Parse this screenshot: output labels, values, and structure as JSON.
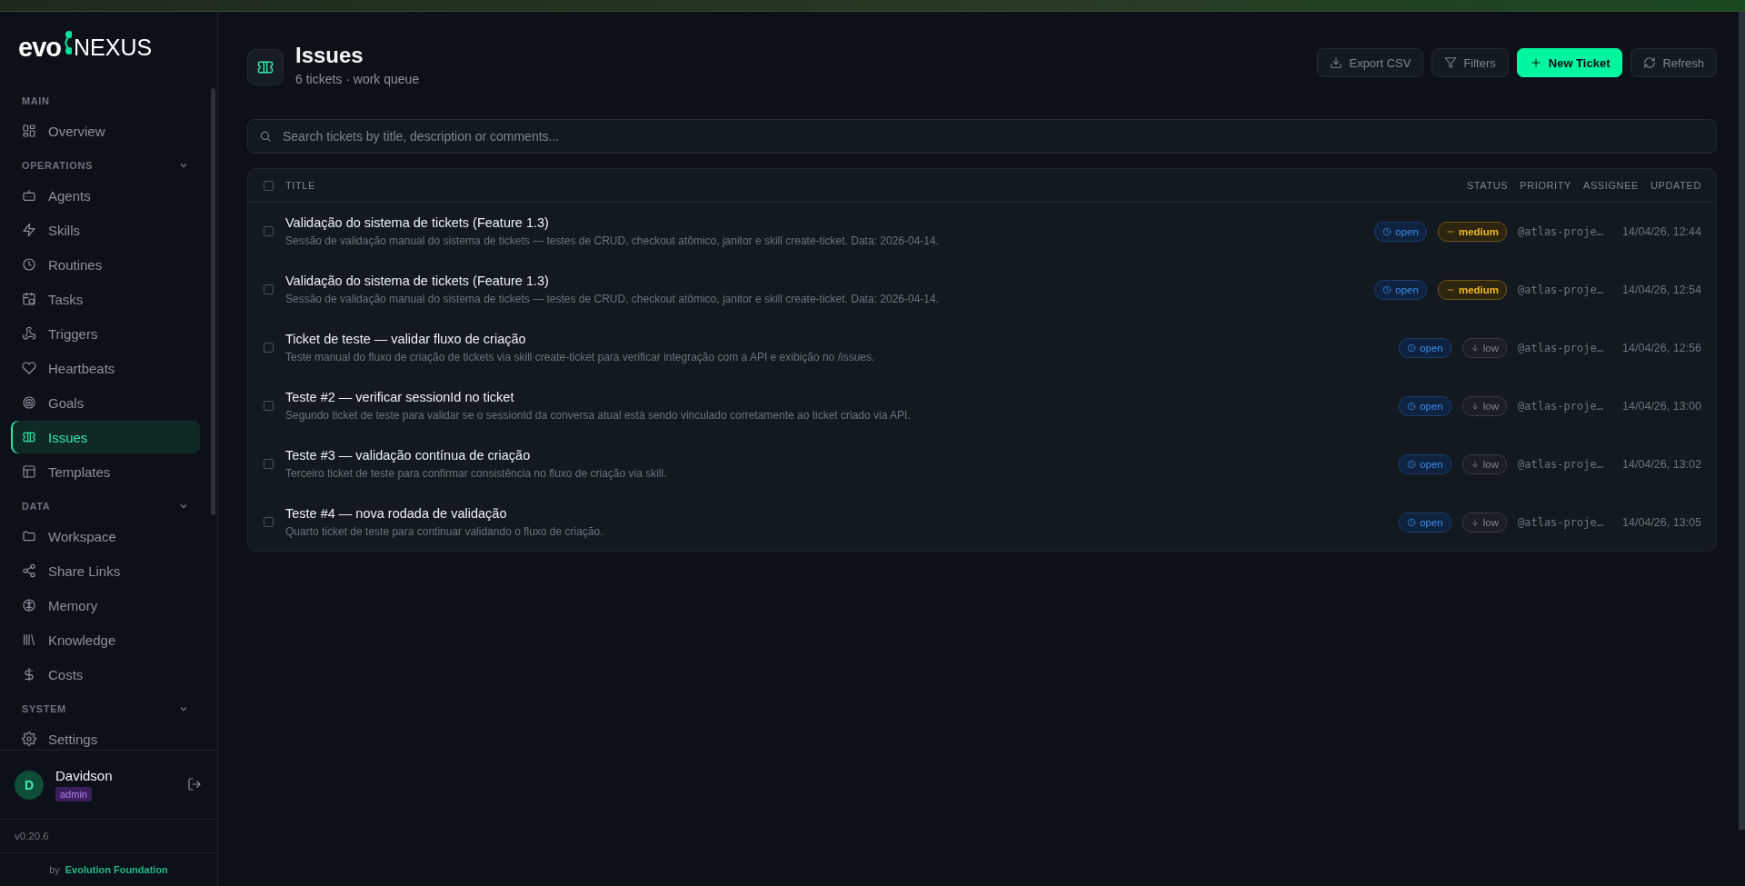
{
  "logo": {
    "mark": "evo",
    "name": "NEXUS"
  },
  "sidebar": {
    "sections": [
      {
        "title": "MAIN",
        "kind": "plain",
        "items": [
          {
            "label": "Overview",
            "selected": false
          }
        ]
      },
      {
        "title": "OPERATIONS",
        "kind": "collapsible",
        "expanded": true,
        "items": [
          {
            "label": "Agents",
            "selected": false
          },
          {
            "label": "Skills",
            "selected": false
          },
          {
            "label": "Routines",
            "selected": false
          },
          {
            "label": "Tasks",
            "selected": false
          },
          {
            "label": "Triggers",
            "selected": false
          },
          {
            "label": "Heartbeats",
            "selected": false
          },
          {
            "label": "Goals",
            "selected": false
          },
          {
            "label": "Issues",
            "selected": true
          },
          {
            "label": "Templates",
            "selected": false
          }
        ]
      },
      {
        "title": "DATA",
        "kind": "collapsible",
        "expanded": true,
        "items": [
          {
            "label": "Workspace",
            "selected": false
          },
          {
            "label": "Share Links",
            "selected": false
          },
          {
            "label": "Memory",
            "selected": false
          },
          {
            "label": "Knowledge",
            "selected": false
          },
          {
            "label": "Costs",
            "selected": false
          }
        ]
      },
      {
        "title": "SYSTEM",
        "kind": "collapsible",
        "expanded": true,
        "items": [
          {
            "label": "Settings",
            "selected": false
          }
        ]
      }
    ]
  },
  "user": {
    "initial": "D",
    "name": "Davidson",
    "role": "admin"
  },
  "version": "v0.20.6",
  "credit": {
    "prefix": "by",
    "link": "Evolution Foundation"
  },
  "page": {
    "title": "Issues",
    "subtitle": "6 tickets · work queue"
  },
  "actions": [
    {
      "label": "Export CSV",
      "kind": "export"
    },
    {
      "label": "Filters",
      "kind": "filter"
    },
    {
      "label": "New Ticket",
      "kind": "primary"
    },
    {
      "label": "Refresh",
      "kind": "refresh"
    }
  ],
  "search": {
    "placeholder": "Search tickets by title, description or comments..."
  },
  "table": {
    "select_all_checked": false,
    "columns": [
      "TITLE",
      "STATUS",
      "PRIORITY",
      "ASSIGNEE",
      "UPDATED"
    ],
    "rows": [
      {
        "checked": false,
        "title": "Validação do sistema de tickets (Feature 1.3)",
        "description": "Sessão de validação manual do sistema de tickets — testes de CRUD, checkout atômico, janitor e skill create-ticket. Data: 2026-04-14.",
        "status": {
          "label": "open",
          "kind": "open"
        },
        "priority": {
          "label": "medium",
          "kind": "medium"
        },
        "assignee": "@atlas-proje…",
        "updated": "14/04/26, 12:44"
      },
      {
        "checked": false,
        "title": "Validação do sistema de tickets (Feature 1.3)",
        "description": "Sessão de validação manual do sistema de tickets — testes de CRUD, checkout atômico, janitor e skill create-ticket. Data: 2026-04-14.",
        "status": {
          "label": "open",
          "kind": "open"
        },
        "priority": {
          "label": "medium",
          "kind": "medium"
        },
        "assignee": "@atlas-proje…",
        "updated": "14/04/26, 12:54"
      },
      {
        "checked": false,
        "title": "Ticket de teste — validar fluxo de criação",
        "description": "Teste manual do fluxo de criação de tickets via skill create-ticket para verificar integração com a API e exibição no /issues.",
        "status": {
          "label": "open",
          "kind": "open"
        },
        "priority": {
          "label": "low",
          "kind": "low"
        },
        "assignee": "@atlas-proje…",
        "updated": "14/04/26, 12:56"
      },
      {
        "checked": false,
        "title": "Teste #2 — verificar sessionId no ticket",
        "description": "Segundo ticket de teste para validar se o sessionId da conversa atual está sendo vinculado corretamente ao ticket criado via API.",
        "status": {
          "label": "open",
          "kind": "open"
        },
        "priority": {
          "label": "low",
          "kind": "low"
        },
        "assignee": "@atlas-proje…",
        "updated": "14/04/26, 13:00"
      },
      {
        "checked": false,
        "title": "Teste #3 — validação contínua de criação",
        "description": "Terceiro ticket de teste para confirmar consistência no fluxo de criação via skill.",
        "status": {
          "label": "open",
          "kind": "open"
        },
        "priority": {
          "label": "low",
          "kind": "low"
        },
        "assignee": "@atlas-proje…",
        "updated": "14/04/26, 13:02"
      },
      {
        "checked": false,
        "title": "Teste #4 — nova rodada de validação",
        "description": "Quarto ticket de teste para continuar validando o fluxo de criação.",
        "status": {
          "label": "open",
          "kind": "open"
        },
        "priority": {
          "label": "low",
          "kind": "low"
        },
        "assignee": "@atlas-proje…",
        "updated": "14/04/26, 13:05"
      }
    ]
  }
}
